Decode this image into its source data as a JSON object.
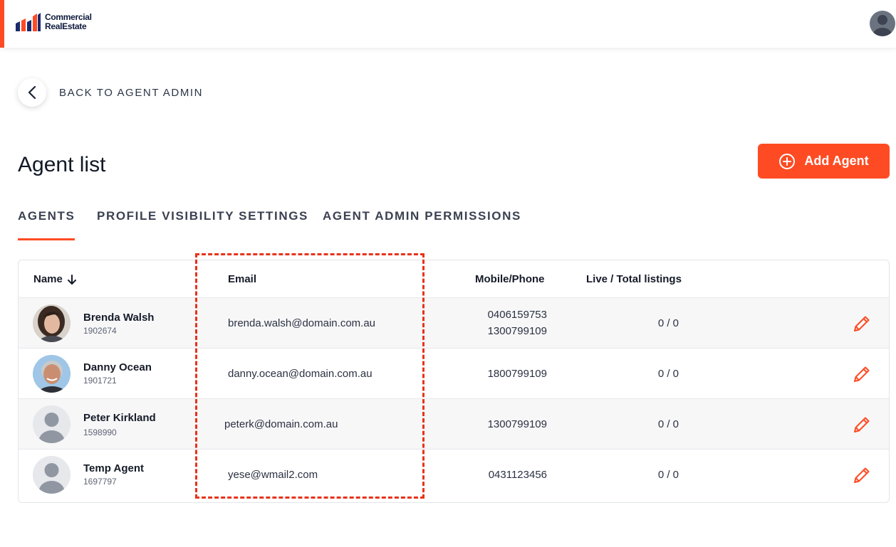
{
  "brand": {
    "line1": "Commercial",
    "line2": "RealEstate",
    "accent": "#ff4b23"
  },
  "nav": {
    "back_label": "BACK TO AGENT ADMIN"
  },
  "page": {
    "title": "Agent list",
    "add_button_label": "Add Agent"
  },
  "tabs": [
    {
      "label": "AGENTS",
      "active": true
    },
    {
      "label": "PROFILE VISIBILITY SETTINGS",
      "active": false
    },
    {
      "label": "AGENT ADMIN PERMISSIONS",
      "active": false
    }
  ],
  "table": {
    "headers": {
      "name": "Name",
      "sort_icon": "arrow-down-icon",
      "email": "Email",
      "phone": "Mobile/Phone",
      "listings": "Live / Total listings"
    },
    "rows": [
      {
        "name": "Brenda Walsh",
        "id": "1902674",
        "email": "brenda.walsh@domain.com.au",
        "phone1": "0406159753",
        "phone2": "1300799109",
        "listings": "0 / 0",
        "avatar": "photo"
      },
      {
        "name": "Danny Ocean",
        "id": "1901721",
        "email": "danny.ocean@domain.com.au",
        "phone1": "1800799109",
        "phone2": "",
        "listings": "0 / 0",
        "avatar": "photo"
      },
      {
        "name": "Peter Kirkland",
        "id": "1598990",
        "email": "peterk@domain.com.au",
        "phone1": "1300799109",
        "phone2": "",
        "listings": "0 / 0",
        "avatar": "placeholder"
      },
      {
        "name": "Temp Agent",
        "id": "1697797",
        "email": "yese@wmail2.com",
        "phone1": "0431123456",
        "phone2": "",
        "listings": "0 / 0",
        "avatar": "placeholder"
      }
    ]
  },
  "annotation": {
    "color": "#e8321a"
  }
}
